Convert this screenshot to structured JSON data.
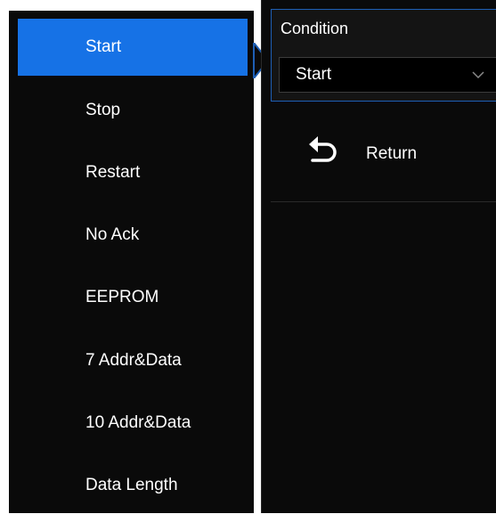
{
  "menu": {
    "items": [
      {
        "label": "Start",
        "selected": true
      },
      {
        "label": "Stop",
        "selected": false
      },
      {
        "label": "Restart",
        "selected": false
      },
      {
        "label": "No Ack",
        "selected": false
      },
      {
        "label": "EEPROM",
        "selected": false
      },
      {
        "label": "7 Addr&Data",
        "selected": false
      },
      {
        "label": "10 Addr&Data",
        "selected": false
      },
      {
        "label": "Data Length",
        "selected": false
      }
    ]
  },
  "condition": {
    "label": "Condition",
    "value": "Start",
    "dropdown_icon": "chevron-down-icon"
  },
  "return_button": {
    "label": "Return",
    "icon": "return-arrow-icon"
  },
  "colors": {
    "selected": "#1672e6",
    "panel_bg": "#0a0a0a",
    "text": "#ffffff",
    "accent_border": "#1e5fb5"
  }
}
